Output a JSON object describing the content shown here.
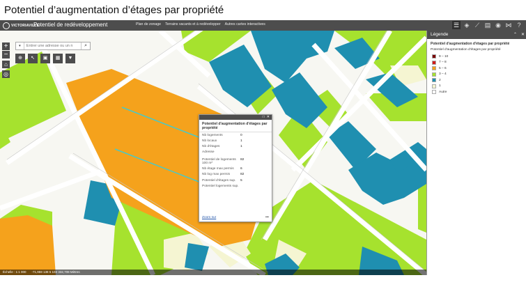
{
  "slide": {
    "title": "Potentiel d’augmentation d’étages par propriété"
  },
  "app": {
    "logo_text": "VICTORIAVILLE",
    "title": "Potentiel de redéveloppement",
    "nav": [
      "Plan de zonage",
      "Terrains vacants et à redévelopper",
      "Autres cartes interactives"
    ],
    "toolbar_icons": [
      "list-icon",
      "layers-icon",
      "ruler-icon",
      "print-icon",
      "eye-icon",
      "share-icon",
      "help-icon"
    ]
  },
  "search": {
    "placeholder": "Entrer une adresse ou un n",
    "dropdown_glyph": "▾",
    "button_glyph": "⌕"
  },
  "zoom": {
    "in": "+",
    "out": "−"
  },
  "statusbar": {
    "scale": "Échelle : 1:1 000",
    "coords": "-71,959 138  5 103 332,708 Mètres"
  },
  "popup": {
    "title": "Potentiel d'augmentation d'étages par propriété",
    "rows": [
      {
        "label": "Nb logements",
        "value": "0"
      },
      {
        "label": "Nb locaux",
        "value": "1"
      },
      {
        "label": "Nb d'étages",
        "value": "1"
      },
      {
        "label": "Adresse",
        "value": ""
      },
      {
        "label": "Potentiel de logements 100 m²",
        "value": "82"
      },
      {
        "label": "Nb étage max permis",
        "value": "6"
      },
      {
        "label": "Nb log max permis",
        "value": "82"
      },
      {
        "label": "Potentiel d'étages sup.",
        "value": "5"
      },
      {
        "label": "Potentiel logements sup.",
        "value": ""
      }
    ],
    "zoom_link": "Zoom sur",
    "more": "•••"
  },
  "legend": {
    "header": "Légende",
    "layer": "Potentiel d'augmentation d'étages par propriété",
    "field": "Potentiel d'augmentation d'étages par propriété",
    "items": [
      {
        "label": "9 – 10",
        "color": "#7a0000"
      },
      {
        "label": "7 – 8",
        "color": "#d11a1a"
      },
      {
        "label": "5 – 6",
        "color": "#f5a21c"
      },
      {
        "label": "3 – 4",
        "color": "#a6e22e"
      },
      {
        "label": "2",
        "color": "#1f8fb0"
      },
      {
        "label": "1",
        "color": "#f5f5d2"
      },
      {
        "label": "Autre",
        "color": "#ffffff"
      }
    ]
  },
  "colors": {
    "orange": "#f5a21c",
    "green": "#a6e22e",
    "teal": "#1f8fb0",
    "cream": "#f5f5d2",
    "bar": "#4d4d4d"
  }
}
